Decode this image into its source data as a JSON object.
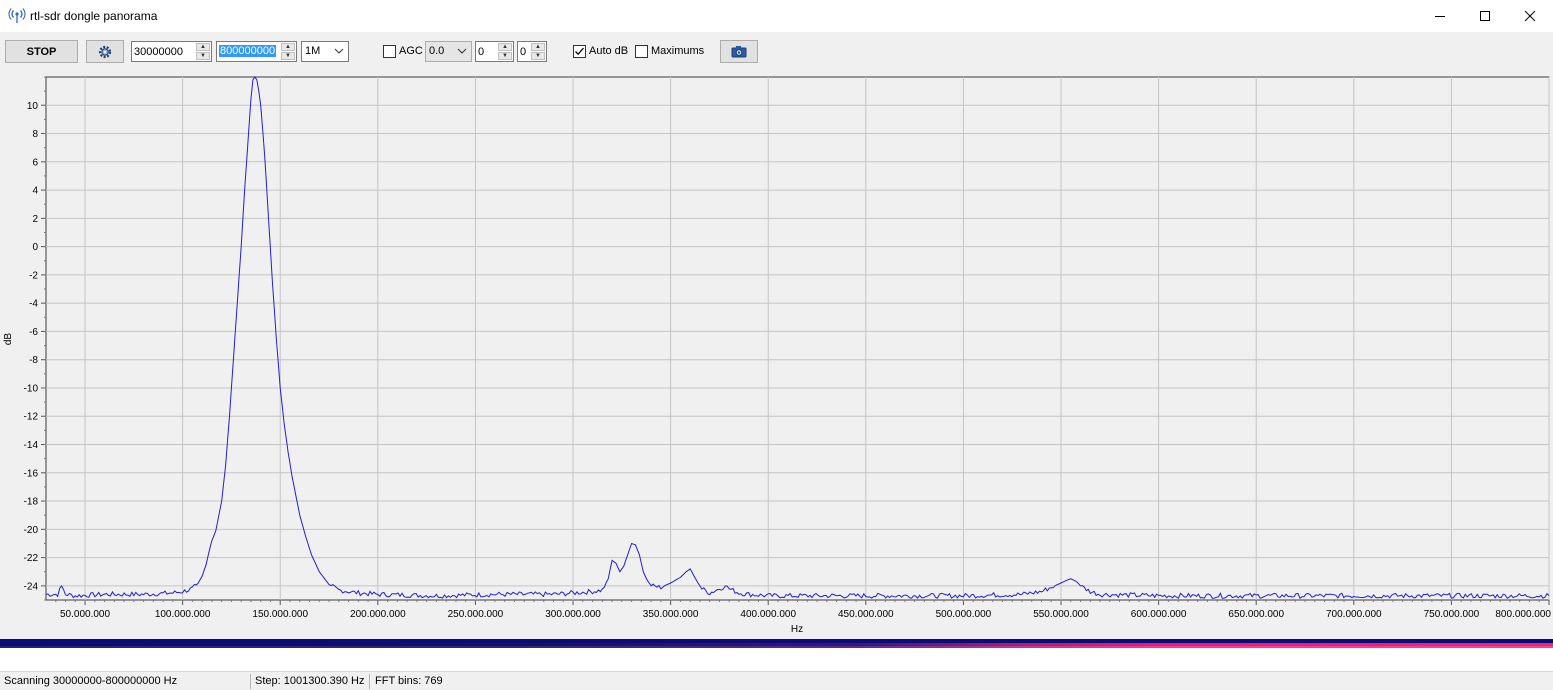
{
  "window": {
    "title": "rtl-sdr dongle panorama",
    "app_icon": "radio-antenna-icon",
    "minimize_icon": "minimize-icon",
    "maximize_icon": "maximize-icon",
    "close_icon": "close-icon"
  },
  "toolbar": {
    "stop_label": "STOP",
    "settings_icon": "gear-icon",
    "start_freq": "30000000",
    "end_freq": "800000000",
    "bandwidth": "1M",
    "agc_label": "AGC",
    "agc_checked": false,
    "gain": "0.0",
    "spin1": "0",
    "spin2": "0",
    "auto_db_label": "Auto dB",
    "auto_db_checked": true,
    "maximums_label": "Maximums",
    "maximums_checked": false,
    "screenshot_icon": "camera-icon"
  },
  "chart_data": {
    "type": "line",
    "xlabel": "Hz",
    "ylabel": "dB",
    "xlim": [
      30000000,
      800000000
    ],
    "ylim": [
      -25,
      12
    ],
    "grid": true,
    "x_ticks": [
      50000000,
      100000000,
      150000000,
      200000000,
      250000000,
      300000000,
      350000000,
      400000000,
      450000000,
      500000000,
      550000000,
      600000000,
      650000000,
      700000000,
      750000000,
      800000000
    ],
    "x_tick_labels": [
      "50.000.000",
      "100.000.000",
      "150.000.000",
      "200.000.000",
      "250.000.000",
      "300.000.000",
      "350.000.000",
      "400.000.000",
      "450.000.000",
      "500.000.000",
      "550.000.000",
      "600.000.000",
      "650.000.000",
      "700.000.000",
      "750.000.000",
      "800.000.000"
    ],
    "y_ticks": [
      10,
      8,
      6,
      4,
      2,
      0,
      -2,
      -4,
      -6,
      -8,
      -10,
      -12,
      -14,
      -16,
      -18,
      -20,
      -22,
      -24
    ],
    "y_tick_labels": [
      "10",
      "8",
      "6",
      "4",
      "2",
      "0",
      "-2",
      "-4",
      "-6",
      "-8",
      "-10",
      "-12",
      "-14",
      "-16",
      "-18",
      "-20",
      "-22",
      "-24"
    ],
    "series": [
      {
        "color": "#1f1fd6",
        "x": [
          30000000,
          36000000,
          38000000,
          40000000,
          45000000,
          60000000,
          80000000,
          95000000,
          100000000,
          105000000,
          108000000,
          110000000,
          112000000,
          114000000,
          115000000,
          117000000,
          120000000,
          122000000,
          124000000,
          126000000,
          128000000,
          130000000,
          132000000,
          134000000,
          135000000,
          136000000,
          137000000,
          138000000,
          139000000,
          140000000,
          142000000,
          144000000,
          146000000,
          148000000,
          150000000,
          152000000,
          154000000,
          156000000,
          158000000,
          160000000,
          163000000,
          166000000,
          170000000,
          175000000,
          180000000,
          190000000,
          200000000,
          230000000,
          260000000,
          290000000,
          300000000,
          310000000,
          315000000,
          318000000,
          320000000,
          322000000,
          324000000,
          326000000,
          328000000,
          330000000,
          332000000,
          334000000,
          336000000,
          338000000,
          340000000,
          345000000,
          350000000,
          355000000,
          358000000,
          360000000,
          362000000,
          364000000,
          366000000,
          370000000,
          375000000,
          378000000,
          380000000,
          385000000,
          390000000,
          400000000,
          450000000,
          500000000,
          530000000,
          540000000,
          545000000,
          550000000,
          553000000,
          555000000,
          558000000,
          560000000,
          565000000,
          570000000,
          600000000,
          650000000,
          700000000,
          750000000,
          800000000
        ],
        "y": [
          -24.6,
          -24.6,
          -24.0,
          -24.6,
          -24.7,
          -24.6,
          -24.6,
          -24.5,
          -24.4,
          -24.2,
          -23.8,
          -23.3,
          -22.5,
          -21.3,
          -20.8,
          -20.1,
          -18.0,
          -15.5,
          -12.0,
          -8.0,
          -4.0,
          0.0,
          4.5,
          8.5,
          10.5,
          11.8,
          12.0,
          11.8,
          11.0,
          10.0,
          6.5,
          2.0,
          -2.5,
          -6.5,
          -10.0,
          -12.5,
          -14.5,
          -16.2,
          -17.6,
          -19.0,
          -20.5,
          -21.8,
          -23.0,
          -23.9,
          -24.3,
          -24.5,
          -24.6,
          -24.7,
          -24.6,
          -24.6,
          -24.5,
          -24.4,
          -24.3,
          -23.5,
          -22.2,
          -22.4,
          -23.0,
          -22.6,
          -21.8,
          -21.0,
          -21.1,
          -21.8,
          -23.0,
          -23.6,
          -24.0,
          -24.1,
          -23.8,
          -23.4,
          -23.0,
          -22.8,
          -23.3,
          -23.8,
          -24.2,
          -24.5,
          -24.2,
          -24.0,
          -24.2,
          -24.5,
          -24.6,
          -24.7,
          -24.7,
          -24.7,
          -24.6,
          -24.4,
          -24.1,
          -23.8,
          -23.6,
          -23.5,
          -23.7,
          -24.0,
          -24.4,
          -24.6,
          -24.7,
          -24.7,
          -24.7,
          -24.7,
          -24.7
        ]
      }
    ]
  },
  "status": {
    "scanning": "Scanning 30000000-800000000 Hz",
    "step": "Step: 1001300.390 Hz",
    "fft_bins": "FFT bins: 769"
  }
}
